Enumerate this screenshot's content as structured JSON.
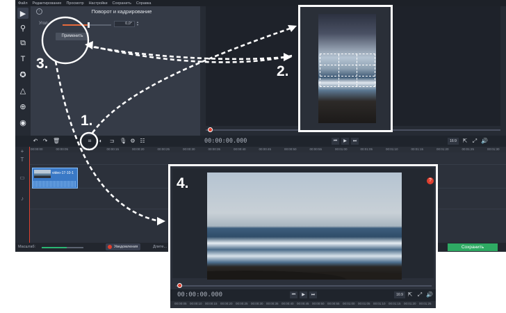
{
  "menu": [
    "Файл",
    "Редактирование",
    "Просмотр",
    "Настройки",
    "Сохранить",
    "Справка"
  ],
  "crop_panel": {
    "title": "Поворот и кадрирование",
    "angle_label": "Угол:",
    "angle_value": "0,0°",
    "angle_slider_level": 0.52,
    "apply_label": "Применить"
  },
  "player": {
    "timecode": "00:00:00.000",
    "aspect_ratio": "16:9"
  },
  "timeline": {
    "ruler_ticks": [
      "00:00:00",
      "00:00:05",
      "00:00:10",
      "00:00:15",
      "00:00:20",
      "00:00:25",
      "00:00:30",
      "00:00:35",
      "00:00:40",
      "00:00:45",
      "00:00:50",
      "00:00:55",
      "00:01:00",
      "00:01:05",
      "00:01:10",
      "00:01:15",
      "00:01:20",
      "00:01:25",
      "00:01:30"
    ],
    "clip_name": "video-17-10-1"
  },
  "statusbar": {
    "scale_label": "Масштаб:",
    "scale_level": 0.6,
    "notifications_label": "Уведомления",
    "duration_label": "Длите...",
    "save_label": "Сохранить"
  },
  "inset4": {
    "timecode": "00:00:00.000",
    "aspect_ratio": "16:9",
    "help_icon": "?",
    "ruler_ticks": [
      "00:00:05",
      "00:00:10",
      "00:00:15",
      "00:00:20",
      "00:00:25",
      "00:00:30",
      "00:00:35",
      "00:00:40",
      "00:00:45",
      "00:00:50",
      "00:00:55",
      "00:01:00",
      "00:01:05",
      "00:01:10",
      "00:01:15",
      "00:01:20",
      "00:01:25"
    ]
  },
  "steps": {
    "one": "1.",
    "two": "2.",
    "three": "3.",
    "four": "4."
  },
  "colors": {
    "accent": "#e76a3b",
    "save": "#2eaa63",
    "clip": "#3a79c6",
    "playhead": "#e0402f"
  },
  "icons": [
    "import-icon",
    "magic-wand-icon",
    "transitions-icon",
    "text-icon",
    "stickers-icon",
    "shapes-icon",
    "zoom-icon",
    "record-icon",
    "undo-icon",
    "redo-icon",
    "trash-icon",
    "crop-icon",
    "split-icon",
    "audio-icon",
    "settings-icon",
    "equalizer-icon",
    "fullscreen-icon",
    "volume-icon"
  ]
}
